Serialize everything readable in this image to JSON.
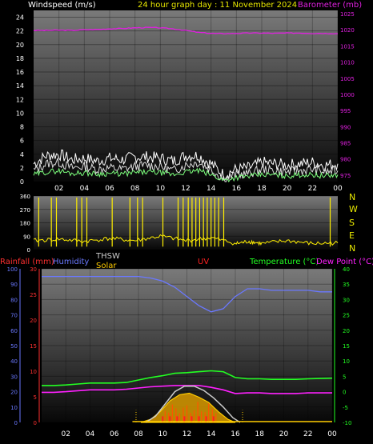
{
  "header": {
    "title": "24 hour graph day : 11 November 2024",
    "left_label": "Windspeed (m/s)",
    "right_label": "Barometer (mb)"
  },
  "colors": {
    "title": "#e8e800",
    "windspeed": "#dcdcdc",
    "gust": "#ffffff",
    "avg_wind": "#7cff7c",
    "barometer": "#e020e0",
    "wind_direction": "#ffee00",
    "rainfall": "#ff3030",
    "humidity": "#6a78ff",
    "thsw": "#cccccc",
    "solar": "#ffcc00",
    "uv": "#ff2020",
    "temperature": "#22ff22",
    "dew_point": "#ff20ff"
  },
  "chart_data": [
    {
      "type": "line",
      "name": "wind-barometer",
      "x_ticks": [
        "02",
        "04",
        "06",
        "08",
        "10",
        "12",
        "14",
        "16",
        "18",
        "20",
        "22",
        "00"
      ],
      "left_axis": {
        "label": "Windspeed (m/s)",
        "ticks": [
          "0",
          "2",
          "4",
          "6",
          "8",
          "10",
          "12",
          "14",
          "16",
          "18",
          "20",
          "22",
          "24"
        ],
        "ylim": [
          0,
          25
        ]
      },
      "right_axis": {
        "label": "Barometer (mb)",
        "ticks": [
          "975",
          "980",
          "985",
          "990",
          "995",
          "1000",
          "1005",
          "1010",
          "1015",
          "1020",
          "1025"
        ],
        "ylim": [
          973,
          1026
        ]
      },
      "x": [
        0,
        1,
        2,
        3,
        4,
        5,
        6,
        7,
        8,
        9,
        10,
        11,
        12,
        13,
        14,
        15,
        16,
        17,
        18,
        19,
        20,
        21,
        22,
        23,
        24
      ],
      "barometer": [
        1019.8,
        1019.8,
        1019.9,
        1019.8,
        1020.0,
        1020.1,
        1020.3,
        1020.4,
        1020.6,
        1020.7,
        1020.6,
        1020.3,
        1019.8,
        1019.2,
        1018.9,
        1018.8,
        1018.9,
        1019.0,
        1019.0,
        1018.9,
        1019.0,
        1019.0,
        1018.9,
        1018.9,
        1018.8
      ],
      "windspeed": [
        1.6,
        2.6,
        2.8,
        2.0,
        2.2,
        1.8,
        2.0,
        1.8,
        2.2,
        2.4,
        2.2,
        1.6,
        2.4,
        2.8,
        1.8,
        0.4,
        1.0,
        1.2,
        1.8,
        1.6,
        1.4,
        1.6,
        1.8,
        1.4,
        1.6
      ],
      "gust": [
        2.6,
        3.8,
        4.0,
        3.2,
        3.4,
        3.0,
        3.4,
        3.2,
        3.6,
        3.6,
        3.4,
        3.0,
        3.8,
        3.8,
        2.6,
        1.0,
        1.8,
        2.0,
        2.8,
        2.6,
        2.4,
        2.6,
        2.8,
        2.4,
        2.6
      ],
      "avg_wind": [
        1.0,
        1.4,
        1.6,
        1.2,
        1.3,
        1.1,
        1.2,
        1.1,
        1.3,
        1.4,
        1.3,
        1.0,
        1.4,
        1.6,
        1.0,
        0.2,
        0.6,
        0.8,
        1.0,
        1.0,
        0.8,
        1.0,
        1.0,
        0.8,
        1.0
      ]
    },
    {
      "type": "line",
      "name": "wind-direction",
      "left_axis": {
        "ticks": [
          "0",
          "90",
          "180",
          "270",
          "360"
        ],
        "ylim": [
          0,
          360
        ]
      },
      "right_axis": {
        "ticks": [
          "N",
          "E",
          "S",
          "W",
          "N"
        ]
      },
      "baseline": [
        [
          0,
          60
        ],
        [
          2,
          70
        ],
        [
          4,
          55
        ],
        [
          6,
          75
        ],
        [
          8,
          60
        ],
        [
          10,
          90
        ],
        [
          12,
          60
        ],
        [
          14,
          80
        ],
        [
          16,
          40
        ],
        [
          17,
          55
        ],
        [
          18,
          40
        ],
        [
          20,
          60
        ],
        [
          22,
          40
        ],
        [
          24,
          45
        ]
      ],
      "spikes": [
        0.4,
        1.4,
        1.8,
        3.4,
        3.8,
        4.2,
        6.2,
        7.6,
        8.2,
        8.6,
        10.2,
        11.4,
        11.8,
        12.2,
        12.5,
        12.8,
        13.1,
        13.4,
        13.7,
        14.0,
        14.3,
        14.6,
        15.0,
        23.4
      ]
    },
    {
      "type": "line",
      "name": "weather-bottom",
      "series_labels": [
        "Rainfall (mm)",
        "Humidity",
        "THSW",
        "Solar",
        "UV",
        "Temperature (°C)",
        "Dew Point (°C)"
      ],
      "humidity_axis": {
        "ticks": [
          "0",
          "10",
          "20",
          "30",
          "40",
          "50",
          "60",
          "70",
          "80",
          "90",
          "100"
        ],
        "ylim": [
          0,
          100
        ]
      },
      "rain_axis": {
        "ticks": [
          "0",
          "5",
          "10",
          "15",
          "20",
          "25",
          "30"
        ],
        "ylim": [
          0,
          30
        ]
      },
      "temp_axis": {
        "ticks": [
          "-10",
          "-5",
          "0",
          "5",
          "10",
          "15",
          "20",
          "25",
          "30",
          "35",
          "40"
        ],
        "ylim": [
          -10,
          40
        ]
      },
      "x_ticks": [
        "02",
        "04",
        "06",
        "08",
        "10",
        "12",
        "14",
        "16",
        "18",
        "20",
        "22",
        "00"
      ],
      "x": [
        0,
        1,
        2,
        3,
        4,
        5,
        6,
        7,
        8,
        9,
        10,
        11,
        12,
        13,
        14,
        15,
        16,
        17,
        18,
        19,
        20,
        21,
        22,
        23,
        24
      ],
      "humidity": [
        95,
        95,
        95,
        95,
        95,
        95,
        95,
        95,
        95,
        94,
        92,
        88,
        82,
        76,
        72,
        74,
        82,
        87,
        87,
        86,
        86,
        86,
        86,
        85,
        85
      ],
      "temperature": [
        2.0,
        2.0,
        2.2,
        2.5,
        2.8,
        2.8,
        2.8,
        3.0,
        3.8,
        4.6,
        5.2,
        6.0,
        6.2,
        6.5,
        6.8,
        6.5,
        4.6,
        4.2,
        4.2,
        4.0,
        4.0,
        4.0,
        4.2,
        4.3,
        4.4
      ],
      "dew_point": [
        -0.2,
        -0.2,
        0.0,
        0.3,
        0.6,
        0.6,
        0.6,
        0.8,
        1.2,
        1.6,
        1.8,
        2.0,
        2.0,
        2.0,
        1.4,
        0.6,
        -0.6,
        -0.4,
        -0.4,
        -0.6,
        -0.6,
        -0.6,
        -0.4,
        -0.4,
        -0.4
      ],
      "thsw": [
        [
          8.6,
          -10
        ],
        [
          9.4,
          -8
        ],
        [
          10.2,
          -4
        ],
        [
          11,
          0
        ],
        [
          11.8,
          1.8
        ],
        [
          12.6,
          1.8
        ],
        [
          13.4,
          0.4
        ],
        [
          14.2,
          -2
        ],
        [
          15,
          -5
        ],
        [
          15.8,
          -8.5
        ],
        [
          16.4,
          -10
        ]
      ],
      "solar": [
        [
          8.2,
          -10
        ],
        [
          9,
          -9
        ],
        [
          9.8,
          -6.5
        ],
        [
          10.6,
          -3
        ],
        [
          11.4,
          -1
        ],
        [
          12.2,
          -0.5
        ],
        [
          13,
          -1.8
        ],
        [
          13.8,
          -3.5
        ],
        [
          14.6,
          -6.5
        ],
        [
          15.4,
          -9
        ],
        [
          16,
          -10
        ]
      ],
      "uv": [
        [
          10.0,
          -8
        ],
        [
          10.6,
          -8
        ],
        [
          11.2,
          -8
        ],
        [
          11.8,
          -8
        ],
        [
          12.4,
          -8
        ],
        [
          13.0,
          -8
        ],
        [
          13.6,
          -8
        ],
        [
          14.2,
          -8
        ]
      ]
    }
  ]
}
